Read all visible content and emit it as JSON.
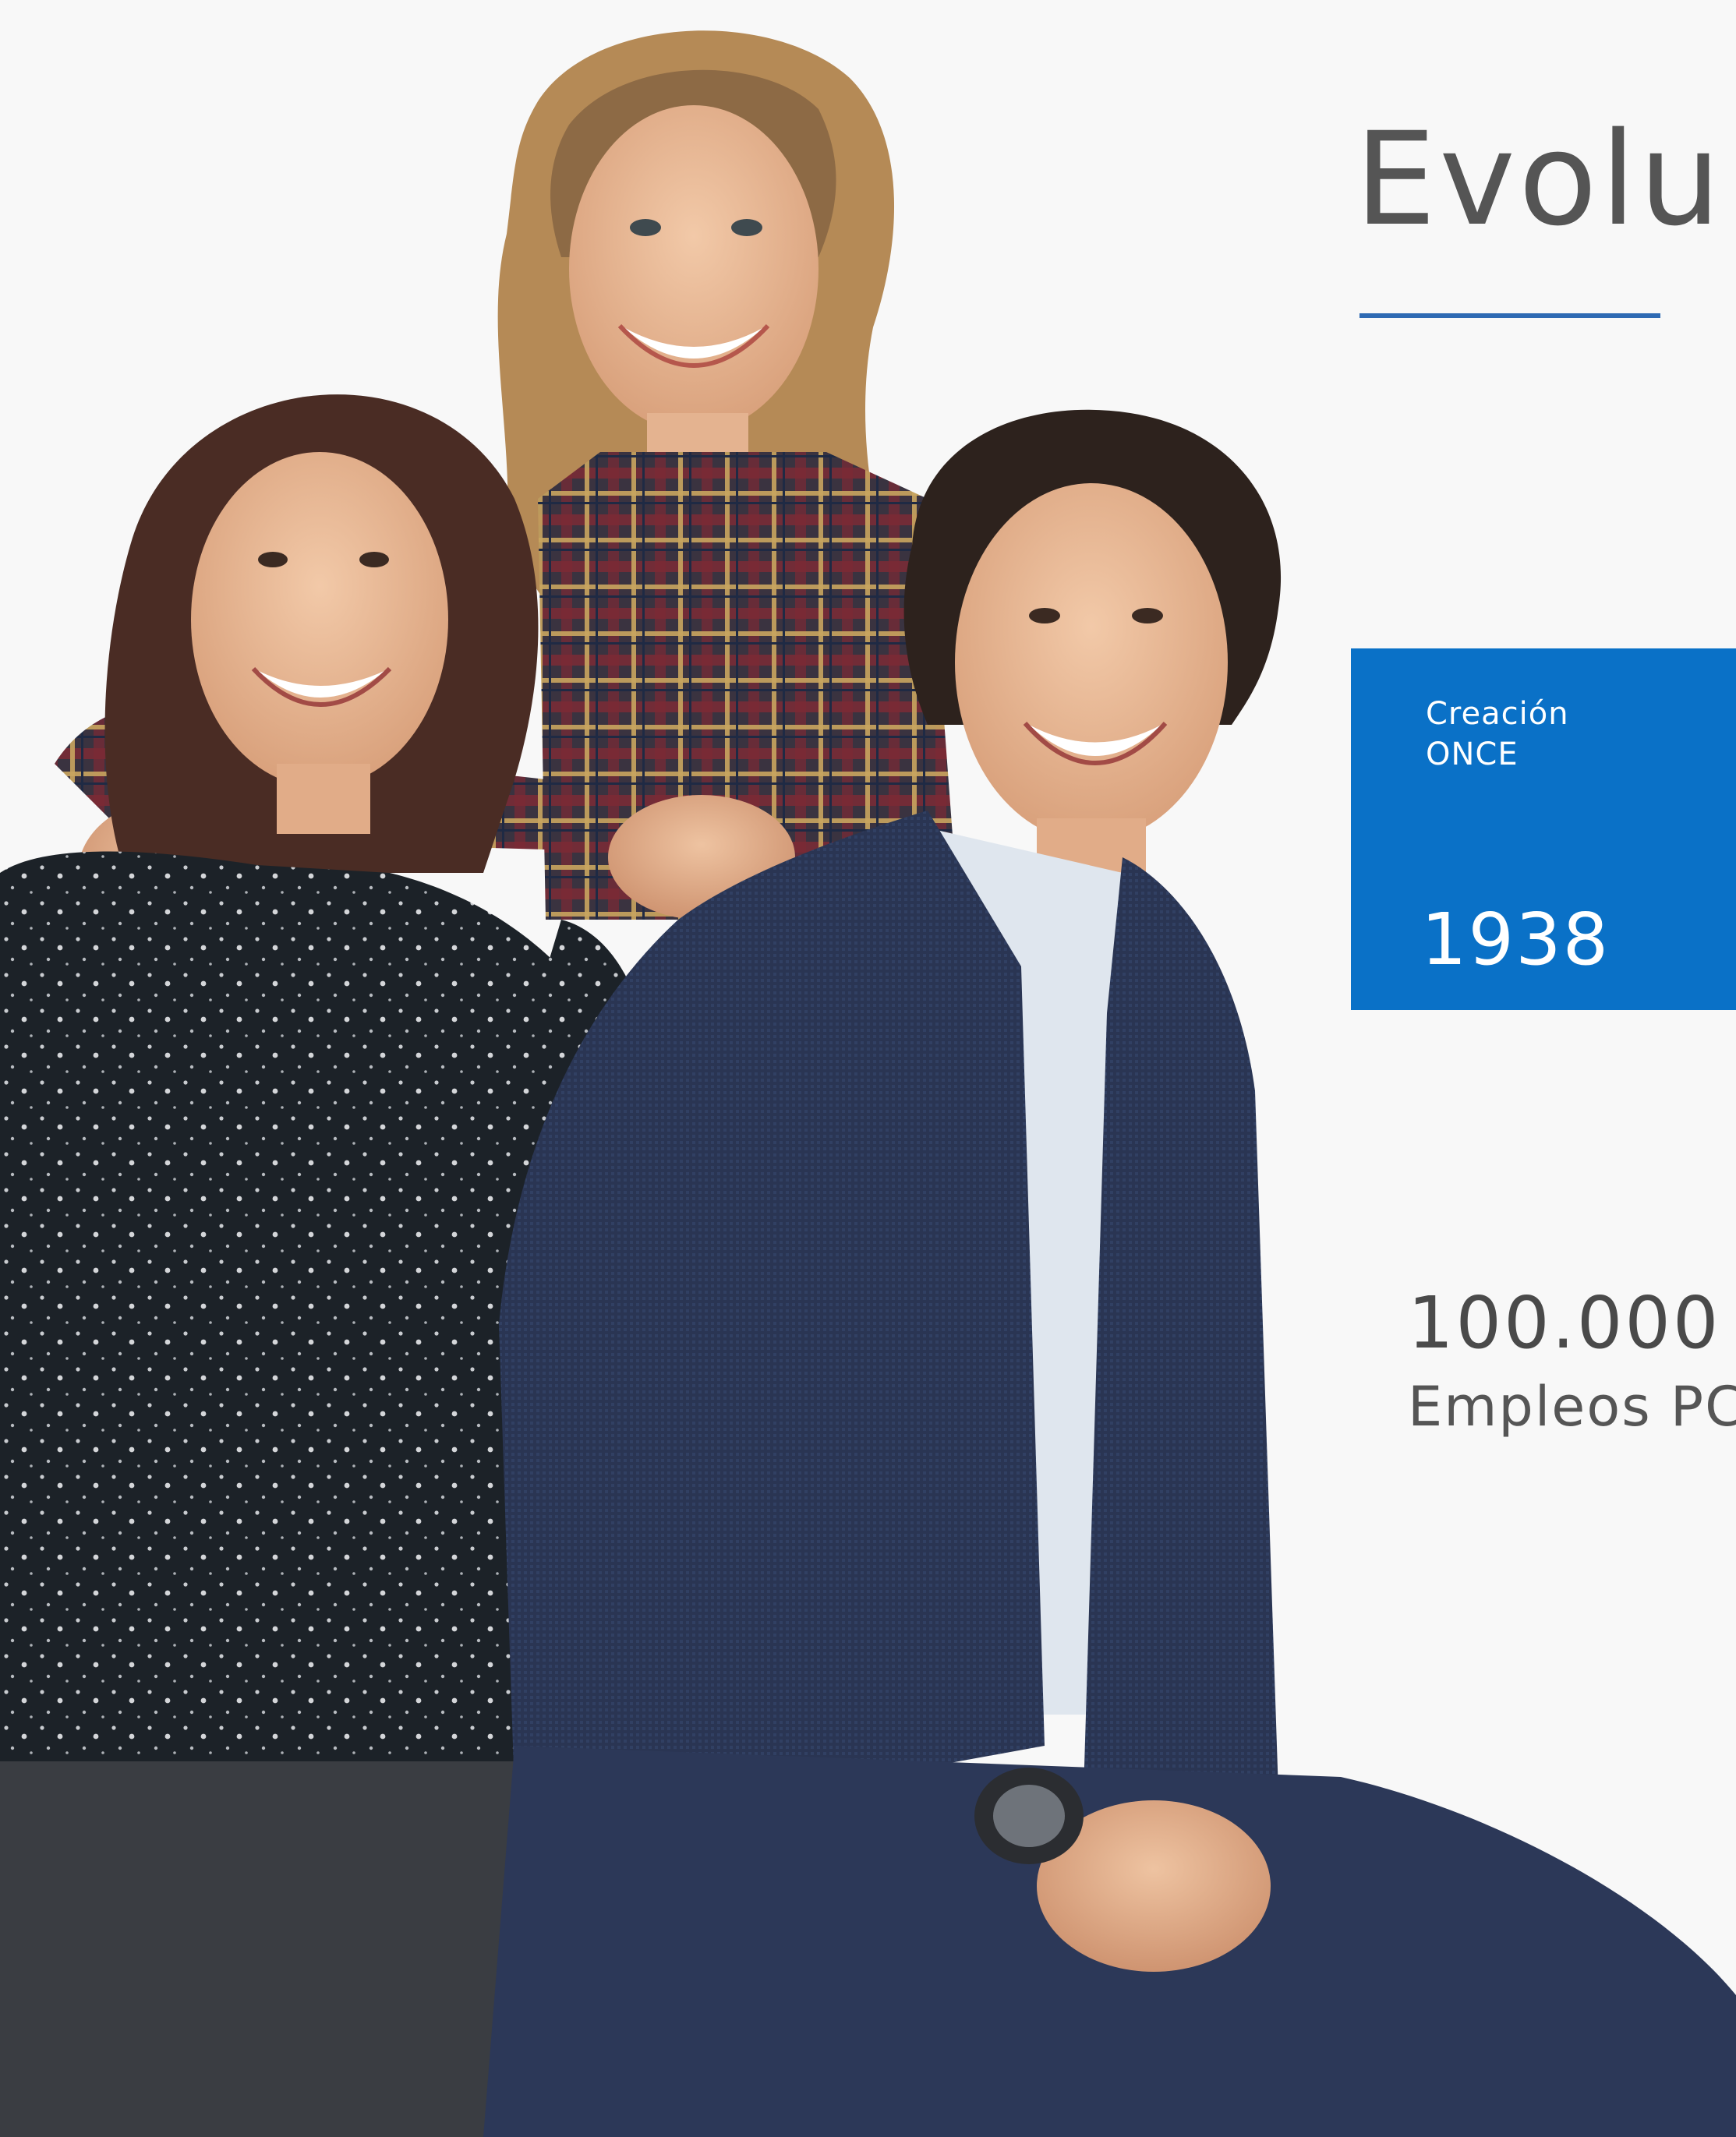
{
  "heading": {
    "title": "Evolu"
  },
  "colors": {
    "accent": "#0a71c7",
    "rule": "#2e6ab3",
    "text": "#555555"
  },
  "card": {
    "label_line1": "Creación",
    "label_line2": "ONCE",
    "year": "1938"
  },
  "stat": {
    "value": "100.000",
    "label": "Empleos PC"
  }
}
